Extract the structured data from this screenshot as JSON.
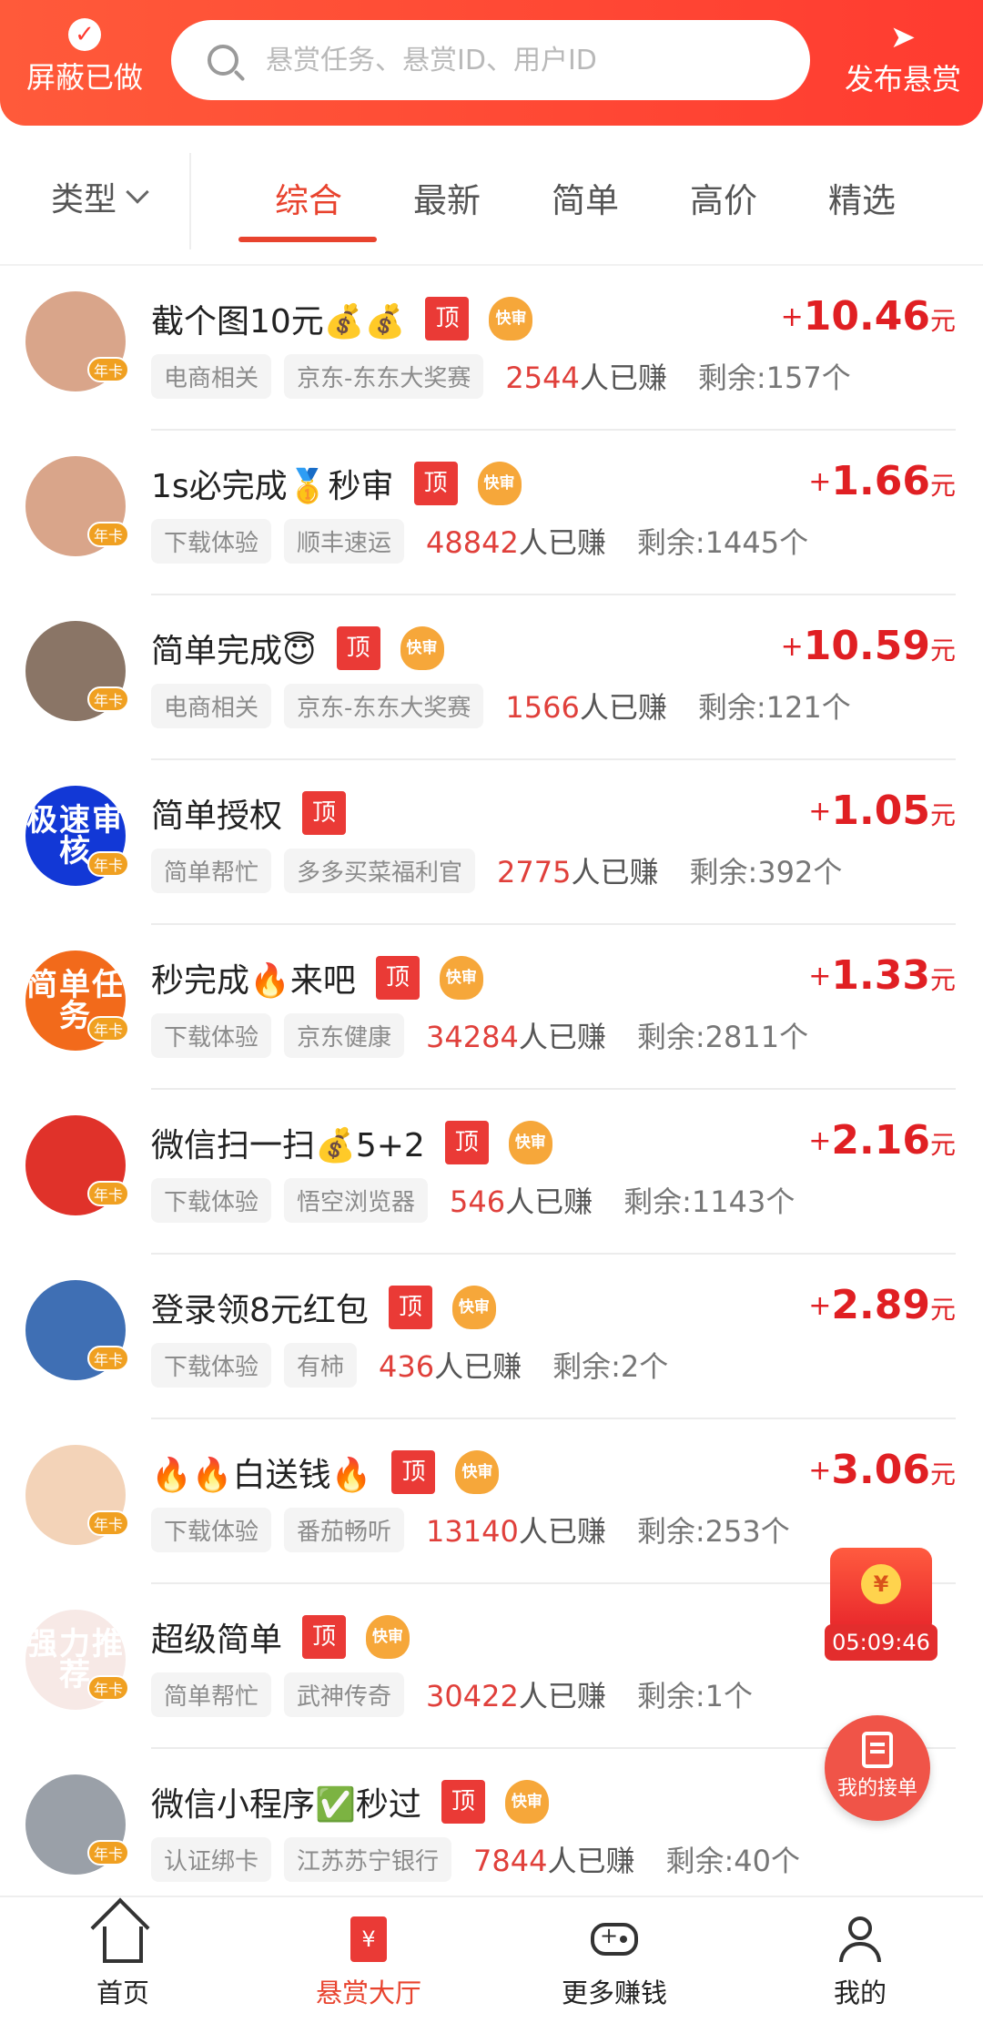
{
  "header": {
    "shield_label": "屏蔽已做",
    "search_placeholder": "悬赏任务、悬赏ID、用户ID",
    "publish_label": "发布悬赏"
  },
  "filter": {
    "type_label": "类型"
  },
  "tabs": [
    {
      "label": "综合",
      "active": true
    },
    {
      "label": "最新",
      "active": false
    },
    {
      "label": "简单",
      "active": false
    },
    {
      "label": "高价",
      "active": false
    },
    {
      "label": "精选",
      "active": false
    }
  ],
  "badges": {
    "top": "顶",
    "fast": "快审",
    "vip": "年卡"
  },
  "labels": {
    "earned_suffix": "人已赚",
    "remaining_prefix": "剩余:",
    "remaining_suffix": "个",
    "price_plus": "+",
    "price_unit": "元"
  },
  "tasks": [
    {
      "title": "截个图10元💰💰",
      "top": true,
      "fast": true,
      "price": "10.46",
      "tags": [
        "电商相关",
        "京东-东东大奖赛"
      ],
      "earned": "2544",
      "remaining": "157",
      "avatar_color": "#d9a58a",
      "avatar_text": ""
    },
    {
      "title": "1s必完成🥇秒审",
      "top": true,
      "fast": true,
      "price": "1.66",
      "tags": [
        "下载体验",
        "顺丰速运"
      ],
      "earned": "48842",
      "remaining": "1445",
      "avatar_color": "#d9a58a",
      "avatar_text": ""
    },
    {
      "title": "简单完成😇",
      "top": true,
      "fast": true,
      "price": "10.59",
      "tags": [
        "电商相关",
        "京东-东东大奖赛"
      ],
      "earned": "1566",
      "remaining": "121",
      "avatar_color": "#8a7566",
      "avatar_text": ""
    },
    {
      "title": "简单授权",
      "top": true,
      "fast": false,
      "price": "1.05",
      "tags": [
        "简单帮忙",
        "多多买菜福利官"
      ],
      "earned": "2775",
      "remaining": "392",
      "avatar_color": "#1238d6",
      "avatar_text": "极速审核"
    },
    {
      "title": "秒完成🔥来吧",
      "top": true,
      "fast": true,
      "price": "1.33",
      "tags": [
        "下载体验",
        "京东健康"
      ],
      "earned": "34284",
      "remaining": "2811",
      "avatar_color": "#f26a1b",
      "avatar_text": "简单任务"
    },
    {
      "title": "微信扫一扫💰5+2",
      "top": true,
      "fast": true,
      "price": "2.16",
      "tags": [
        "下载体验",
        "悟空浏览器"
      ],
      "earned": "546",
      "remaining": "1143",
      "avatar_color": "#e0322a",
      "avatar_text": ""
    },
    {
      "title": "登录领8元红包",
      "top": true,
      "fast": true,
      "price": "2.89",
      "tags": [
        "下载体验",
        "有柿"
      ],
      "earned": "436",
      "remaining": "2",
      "avatar_color": "#3f6fb4",
      "avatar_text": ""
    },
    {
      "title": "🔥🔥白送钱🔥",
      "top": true,
      "fast": true,
      "price": "3.06",
      "tags": [
        "下载体验",
        "番茄畅听"
      ],
      "earned": "13140",
      "remaining": "253",
      "avatar_color": "#f3d3b8",
      "avatar_text": ""
    },
    {
      "title": "超级简单",
      "top": true,
      "fast": true,
      "price": "",
      "tags": [
        "简单帮忙",
        "武神传奇"
      ],
      "earned": "30422",
      "remaining": "1",
      "avatar_color": "#f7e9e6",
      "avatar_text": "强力推荐"
    },
    {
      "title": "微信小程序✅秒过",
      "top": true,
      "fast": true,
      "price": "",
      "tags": [
        "认证绑卡",
        "江苏苏宁银行"
      ],
      "earned": "7844",
      "remaining": "40",
      "avatar_color": "#9aa0a8",
      "avatar_text": ""
    }
  ],
  "floating": {
    "timer": "05:09:46",
    "orders_label": "我的接单"
  },
  "bottom_nav": [
    {
      "label": "首页",
      "active": false
    },
    {
      "label": "悬赏大厅",
      "active": true
    },
    {
      "label": "更多赚钱",
      "active": false
    },
    {
      "label": "我的",
      "active": false
    }
  ]
}
